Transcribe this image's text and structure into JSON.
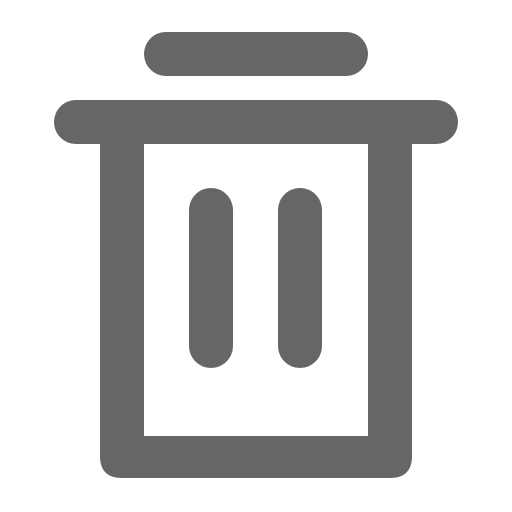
{
  "icon": {
    "name": "trash-icon",
    "color": "#666666",
    "background": "#ffffff"
  }
}
